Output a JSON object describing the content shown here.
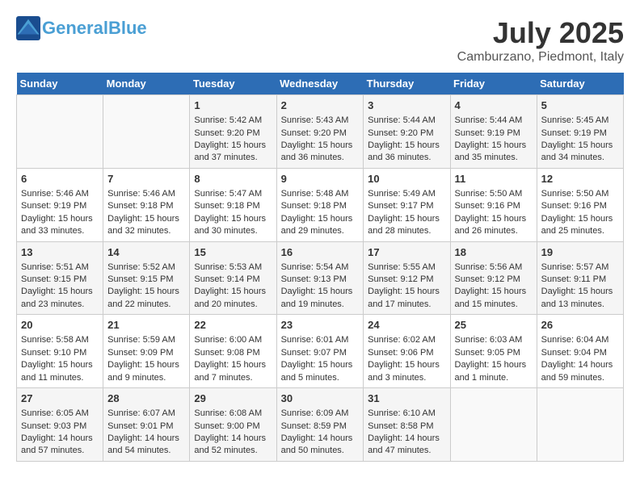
{
  "header": {
    "logo_line1": "General",
    "logo_line2": "Blue",
    "month_title": "July 2025",
    "location": "Camburzano, Piedmont, Italy"
  },
  "days_of_week": [
    "Sunday",
    "Monday",
    "Tuesday",
    "Wednesday",
    "Thursday",
    "Friday",
    "Saturday"
  ],
  "weeks": [
    [
      {
        "day": "",
        "sunrise": "",
        "sunset": "",
        "daylight": ""
      },
      {
        "day": "",
        "sunrise": "",
        "sunset": "",
        "daylight": ""
      },
      {
        "day": "1",
        "sunrise": "Sunrise: 5:42 AM",
        "sunset": "Sunset: 9:20 PM",
        "daylight": "Daylight: 15 hours and 37 minutes."
      },
      {
        "day": "2",
        "sunrise": "Sunrise: 5:43 AM",
        "sunset": "Sunset: 9:20 PM",
        "daylight": "Daylight: 15 hours and 36 minutes."
      },
      {
        "day": "3",
        "sunrise": "Sunrise: 5:44 AM",
        "sunset": "Sunset: 9:20 PM",
        "daylight": "Daylight: 15 hours and 36 minutes."
      },
      {
        "day": "4",
        "sunrise": "Sunrise: 5:44 AM",
        "sunset": "Sunset: 9:19 PM",
        "daylight": "Daylight: 15 hours and 35 minutes."
      },
      {
        "day": "5",
        "sunrise": "Sunrise: 5:45 AM",
        "sunset": "Sunset: 9:19 PM",
        "daylight": "Daylight: 15 hours and 34 minutes."
      }
    ],
    [
      {
        "day": "6",
        "sunrise": "Sunrise: 5:46 AM",
        "sunset": "Sunset: 9:19 PM",
        "daylight": "Daylight: 15 hours and 33 minutes."
      },
      {
        "day": "7",
        "sunrise": "Sunrise: 5:46 AM",
        "sunset": "Sunset: 9:18 PM",
        "daylight": "Daylight: 15 hours and 32 minutes."
      },
      {
        "day": "8",
        "sunrise": "Sunrise: 5:47 AM",
        "sunset": "Sunset: 9:18 PM",
        "daylight": "Daylight: 15 hours and 30 minutes."
      },
      {
        "day": "9",
        "sunrise": "Sunrise: 5:48 AM",
        "sunset": "Sunset: 9:18 PM",
        "daylight": "Daylight: 15 hours and 29 minutes."
      },
      {
        "day": "10",
        "sunrise": "Sunrise: 5:49 AM",
        "sunset": "Sunset: 9:17 PM",
        "daylight": "Daylight: 15 hours and 28 minutes."
      },
      {
        "day": "11",
        "sunrise": "Sunrise: 5:50 AM",
        "sunset": "Sunset: 9:16 PM",
        "daylight": "Daylight: 15 hours and 26 minutes."
      },
      {
        "day": "12",
        "sunrise": "Sunrise: 5:50 AM",
        "sunset": "Sunset: 9:16 PM",
        "daylight": "Daylight: 15 hours and 25 minutes."
      }
    ],
    [
      {
        "day": "13",
        "sunrise": "Sunrise: 5:51 AM",
        "sunset": "Sunset: 9:15 PM",
        "daylight": "Daylight: 15 hours and 23 minutes."
      },
      {
        "day": "14",
        "sunrise": "Sunrise: 5:52 AM",
        "sunset": "Sunset: 9:15 PM",
        "daylight": "Daylight: 15 hours and 22 minutes."
      },
      {
        "day": "15",
        "sunrise": "Sunrise: 5:53 AM",
        "sunset": "Sunset: 9:14 PM",
        "daylight": "Daylight: 15 hours and 20 minutes."
      },
      {
        "day": "16",
        "sunrise": "Sunrise: 5:54 AM",
        "sunset": "Sunset: 9:13 PM",
        "daylight": "Daylight: 15 hours and 19 minutes."
      },
      {
        "day": "17",
        "sunrise": "Sunrise: 5:55 AM",
        "sunset": "Sunset: 9:12 PM",
        "daylight": "Daylight: 15 hours and 17 minutes."
      },
      {
        "day": "18",
        "sunrise": "Sunrise: 5:56 AM",
        "sunset": "Sunset: 9:12 PM",
        "daylight": "Daylight: 15 hours and 15 minutes."
      },
      {
        "day": "19",
        "sunrise": "Sunrise: 5:57 AM",
        "sunset": "Sunset: 9:11 PM",
        "daylight": "Daylight: 15 hours and 13 minutes."
      }
    ],
    [
      {
        "day": "20",
        "sunrise": "Sunrise: 5:58 AM",
        "sunset": "Sunset: 9:10 PM",
        "daylight": "Daylight: 15 hours and 11 minutes."
      },
      {
        "day": "21",
        "sunrise": "Sunrise: 5:59 AM",
        "sunset": "Sunset: 9:09 PM",
        "daylight": "Daylight: 15 hours and 9 minutes."
      },
      {
        "day": "22",
        "sunrise": "Sunrise: 6:00 AM",
        "sunset": "Sunset: 9:08 PM",
        "daylight": "Daylight: 15 hours and 7 minutes."
      },
      {
        "day": "23",
        "sunrise": "Sunrise: 6:01 AM",
        "sunset": "Sunset: 9:07 PM",
        "daylight": "Daylight: 15 hours and 5 minutes."
      },
      {
        "day": "24",
        "sunrise": "Sunrise: 6:02 AM",
        "sunset": "Sunset: 9:06 PM",
        "daylight": "Daylight: 15 hours and 3 minutes."
      },
      {
        "day": "25",
        "sunrise": "Sunrise: 6:03 AM",
        "sunset": "Sunset: 9:05 PM",
        "daylight": "Daylight: 15 hours and 1 minute."
      },
      {
        "day": "26",
        "sunrise": "Sunrise: 6:04 AM",
        "sunset": "Sunset: 9:04 PM",
        "daylight": "Daylight: 14 hours and 59 minutes."
      }
    ],
    [
      {
        "day": "27",
        "sunrise": "Sunrise: 6:05 AM",
        "sunset": "Sunset: 9:03 PM",
        "daylight": "Daylight: 14 hours and 57 minutes."
      },
      {
        "day": "28",
        "sunrise": "Sunrise: 6:07 AM",
        "sunset": "Sunset: 9:01 PM",
        "daylight": "Daylight: 14 hours and 54 minutes."
      },
      {
        "day": "29",
        "sunrise": "Sunrise: 6:08 AM",
        "sunset": "Sunset: 9:00 PM",
        "daylight": "Daylight: 14 hours and 52 minutes."
      },
      {
        "day": "30",
        "sunrise": "Sunrise: 6:09 AM",
        "sunset": "Sunset: 8:59 PM",
        "daylight": "Daylight: 14 hours and 50 minutes."
      },
      {
        "day": "31",
        "sunrise": "Sunrise: 6:10 AM",
        "sunset": "Sunset: 8:58 PM",
        "daylight": "Daylight: 14 hours and 47 minutes."
      },
      {
        "day": "",
        "sunrise": "",
        "sunset": "",
        "daylight": ""
      },
      {
        "day": "",
        "sunrise": "",
        "sunset": "",
        "daylight": ""
      }
    ]
  ]
}
